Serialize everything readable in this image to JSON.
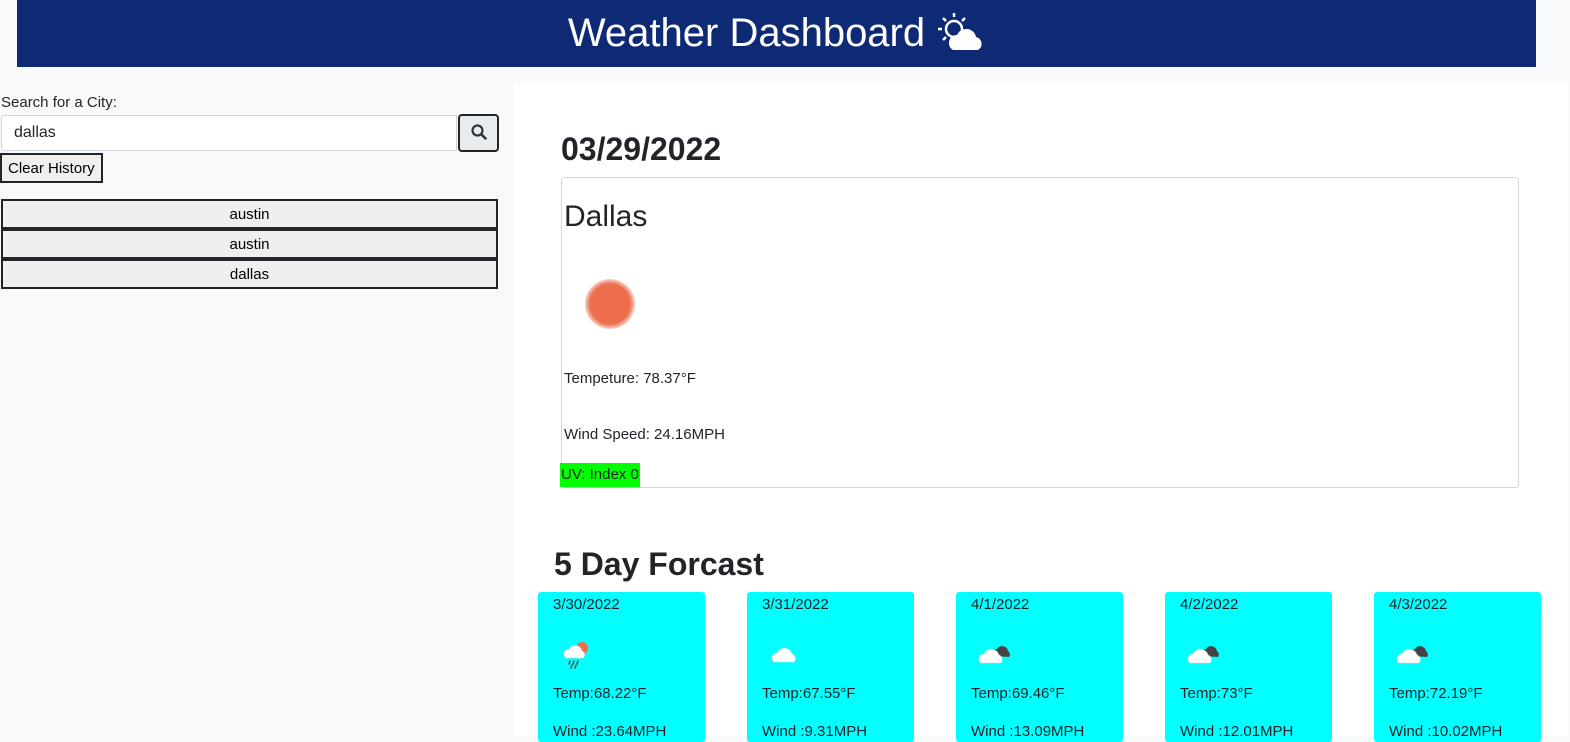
{
  "header": {
    "title": "Weather Dashboard",
    "icon": "sun-behind-cloud-icon"
  },
  "sidebar": {
    "search_label": "Search for a City:",
    "search_value": "dallas",
    "search_icon": "search-icon",
    "clear_label": "Clear History",
    "history": [
      {
        "label": "austin"
      },
      {
        "label": "austin"
      },
      {
        "label": "dallas"
      }
    ]
  },
  "current": {
    "date": "03/29/2022",
    "city": "Dallas",
    "icon": "sun-icon",
    "temperature": "Tempeture: 78.37°F",
    "wind": "Wind Speed: 24.16MPH",
    "uv": "UV: Index 0",
    "uv_color": "#00ff00"
  },
  "forecast": {
    "title": "5 Day Forcast",
    "card_color": "#00ffff",
    "days": [
      {
        "date": "3/30/2022",
        "icon": "rain-sun-cloud-icon",
        "temp": "Temp:68.22°F",
        "wind": "Wind :23.64MPH"
      },
      {
        "date": "3/31/2022",
        "icon": "cloud-icon",
        "temp": "Temp:67.55°F",
        "wind": "Wind :9.31MPH"
      },
      {
        "date": "4/1/2022",
        "icon": "broken-clouds-icon",
        "temp": "Temp:69.46°F",
        "wind": "Wind :13.09MPH"
      },
      {
        "date": "4/2/2022",
        "icon": "broken-clouds-icon",
        "temp": "Temp:73°F",
        "wind": "Wind :12.01MPH"
      },
      {
        "date": "4/3/2022",
        "icon": "broken-clouds-icon",
        "temp": "Temp:72.19°F",
        "wind": "Wind :10.02MPH"
      }
    ]
  },
  "colors": {
    "header_bg": "#0f2a75",
    "header_text": "#ffffff"
  }
}
